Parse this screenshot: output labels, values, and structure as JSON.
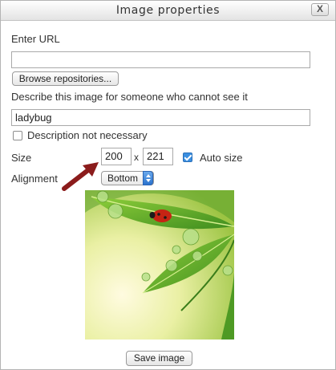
{
  "dialog": {
    "title": "Image properties",
    "close_label": "X"
  },
  "url": {
    "label": "Enter URL",
    "value": "",
    "browse_label": "Browse repositories..."
  },
  "description": {
    "label": "Describe this image for someone who cannot see it",
    "value": "ladybug",
    "not_necessary_label": "Description not necessary",
    "not_necessary_checked": false
  },
  "size": {
    "label": "Size",
    "width": "200",
    "separator": "x",
    "height": "221",
    "auto_size_label": "Auto size",
    "auto_size_checked": true
  },
  "alignment": {
    "label": "Alignment",
    "selected": "Bottom"
  },
  "preview": {
    "subject": "leaves with water drops and a ladybug"
  },
  "footer": {
    "save_label": "Save image"
  },
  "colors": {
    "accent": "#3b8fe0",
    "arrow": "#8b1c1c",
    "leaf": "#6fae2f"
  }
}
